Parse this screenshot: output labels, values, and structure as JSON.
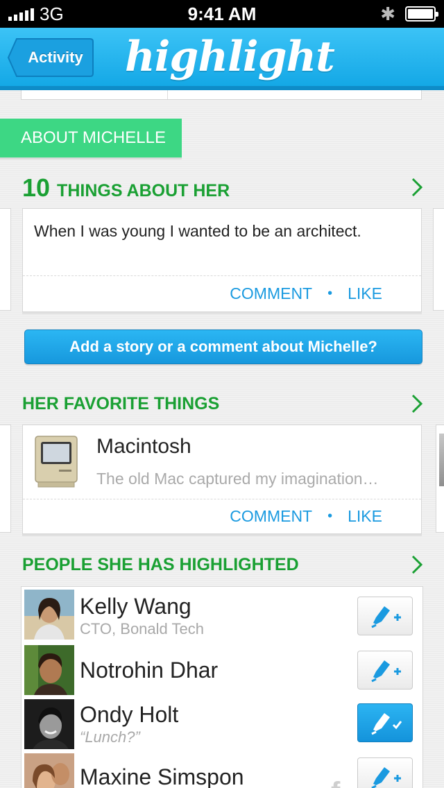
{
  "status_bar": {
    "carrier": "3G",
    "time": "9:41 AM"
  },
  "nav": {
    "back_label": "Activity",
    "logo_text": "highlight"
  },
  "about_tab": {
    "label": "ABOUT MICHELLE"
  },
  "things_section": {
    "count": "10",
    "title": "THINGS ABOUT HER",
    "card_text": "When I was young I wanted to be an architect.",
    "comment_label": "COMMENT",
    "separator": "•",
    "like_label": "LIKE"
  },
  "add_story_button": {
    "label": "Add a story or a comment about Michelle?"
  },
  "favorites_section": {
    "title": "HER FAVORITE THINGS",
    "item_name": "Macintosh",
    "item_desc": "The old Mac captured my imagination…",
    "comment_label": "COMMENT",
    "separator": "•",
    "like_label": "LIKE"
  },
  "people_section": {
    "title": "PEOPLE SHE HAS HIGHLIGHTED",
    "people": [
      {
        "name": "Kelly Wang",
        "subtitle": "CTO, Bonald Tech",
        "highlighted": false
      },
      {
        "name": "Notrohin Dhar",
        "subtitle": "",
        "highlighted": false
      },
      {
        "name": "Ondy Holt",
        "subtitle": "“Lunch?”",
        "highlighted": true
      },
      {
        "name": "Maxine Simspon",
        "subtitle": "",
        "highlighted": false,
        "source_icon": "facebook-icon"
      }
    ]
  },
  "colors": {
    "brand_blue": "#14a8e6",
    "accent_green": "#1aa033",
    "tab_green": "#3dd784",
    "link_blue": "#1a9ae0"
  }
}
